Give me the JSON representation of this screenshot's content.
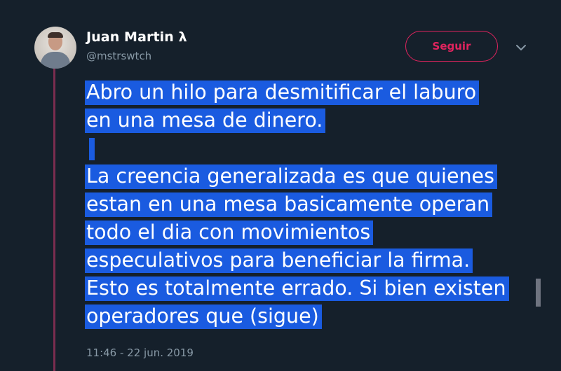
{
  "author": {
    "name": "Juan Martin λ",
    "handle": "@mstrswtch"
  },
  "actions": {
    "follow_label": "Seguir",
    "more_icon": "chevron-down-icon"
  },
  "tweet": {
    "paragraph1": [
      "Abro un hilo para desmitificar el laburo",
      "en una mesa de dinero."
    ],
    "paragraph2": [
      "La creencia generalizada es que quienes",
      "estan en una mesa basicamente operan",
      "todo el dia con movimientos",
      "especulativos para beneficiar la firma.",
      "Esto es totalmente errado. Si bien existen",
      "operadores que (sigue)"
    ],
    "timestamp": "11:46 - 22 jun. 2019"
  },
  "colors": {
    "background": "#15202b",
    "accent": "#e0245e",
    "selection": "#1a5be0",
    "thread_line": "#7a2d4f",
    "secondary_text": "#8899a6"
  }
}
